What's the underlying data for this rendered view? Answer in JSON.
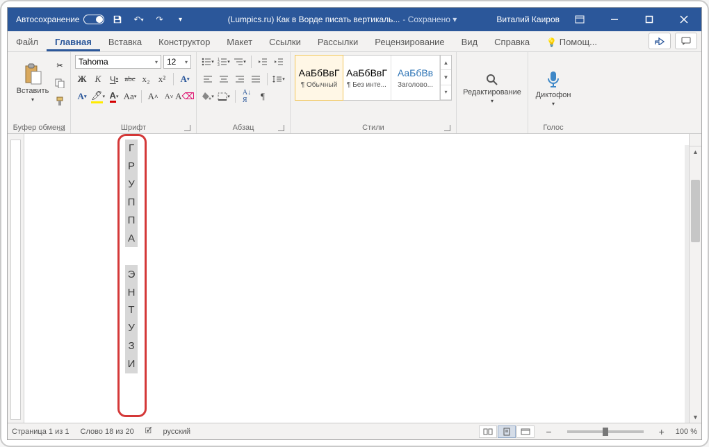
{
  "titlebar": {
    "autosave_label": "Автосохранение",
    "doc_title": "(Lumpics.ru) Как в Ворде писать вертикаль...",
    "saved": " - Сохранено ▾",
    "user": "Виталий Каиров"
  },
  "tabs": {
    "file": "Файл",
    "home": "Главная",
    "insert": "Вставка",
    "design": "Конструктор",
    "layout": "Макет",
    "references": "Ссылки",
    "mailings": "Рассылки",
    "review": "Рецензирование",
    "view": "Вид",
    "help": "Справка",
    "search": "Помощ..."
  },
  "ribbon": {
    "clipboard": {
      "paste": "Вставить",
      "group": "Буфер обмена"
    },
    "font": {
      "name": "Tahoma",
      "size": "12",
      "group": "Шрифт",
      "bold": "Ж",
      "italic": "К",
      "underline": "Ч",
      "strike": "abc",
      "sub": "x₂",
      "sup": "x²"
    },
    "paragraph": {
      "group": "Абзац"
    },
    "styles": {
      "group": "Стили",
      "preview": "АаБбВвГ",
      "preview_h": "АаБбВв",
      "s1": "¶ Обычный",
      "s2": "¶ Без инте...",
      "s3": "Заголово..."
    },
    "editing": "Редактирование",
    "voice": {
      "label": "Диктофон",
      "group": "Голос"
    }
  },
  "document": {
    "chars": [
      "Г",
      "Р",
      "У",
      "П",
      "П",
      "А",
      "",
      "Э",
      "Н",
      "Т",
      "У",
      "З",
      "И"
    ]
  },
  "statusbar": {
    "page": "Страница 1 из 1",
    "words": "Слово 18 из 20",
    "lang": "русский",
    "zoom": "100 %"
  }
}
